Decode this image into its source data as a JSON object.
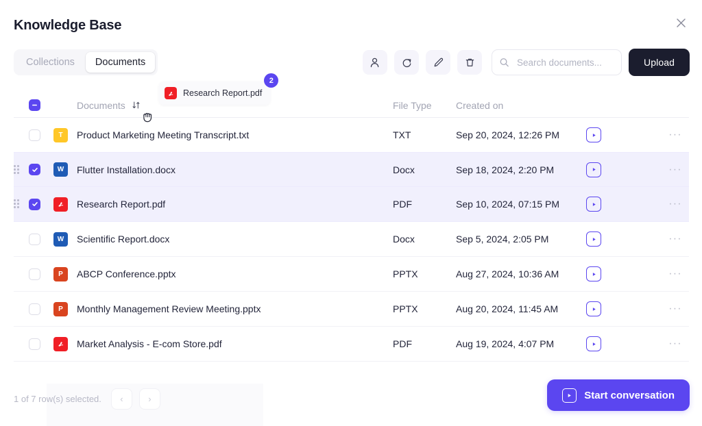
{
  "header": {
    "title": "Knowledge Base",
    "close_icon": "close-icon"
  },
  "tabs": [
    {
      "label": "Collections",
      "active": false
    },
    {
      "label": "Documents",
      "active": true
    }
  ],
  "toolbar": {
    "icons": [
      {
        "name": "user-icon",
        "label": "Share with user"
      },
      {
        "name": "refresh-icon",
        "label": "Re-sync"
      },
      {
        "name": "pencil-icon",
        "label": "Edit"
      },
      {
        "name": "trash-icon",
        "label": "Delete"
      }
    ],
    "search": {
      "placeholder": "Search documents...",
      "value": "",
      "icon": "search-icon"
    },
    "upload_label": "Upload"
  },
  "table": {
    "columns": {
      "name": "Documents",
      "file_type": "File Type",
      "created_on": "Created on"
    },
    "header_checkbox_state": "indeterminate",
    "sort_icon": "sort-arrows-icon",
    "rows": [
      {
        "selected": false,
        "icon": "txt",
        "icon_letter": "T",
        "name": "Product Marketing Meeting Transcript.txt",
        "file_type": "TXT",
        "created_on": "Sep 20, 2024, 12:26 PM",
        "action_icon": "play-icon",
        "more_icon": "more-horizontal-icon"
      },
      {
        "selected": true,
        "icon": "docx",
        "icon_letter": "W",
        "name": "Flutter Installation.docx",
        "file_type": "Docx",
        "created_on": "Sep 18, 2024, 2:20 PM",
        "action_icon": "play-icon",
        "more_icon": "more-horizontal-icon"
      },
      {
        "selected": true,
        "icon": "pdf",
        "icon_letter": "A",
        "name": "Research Report.pdf",
        "file_type": "PDF",
        "created_on": "Sep 10, 2024, 07:15 PM",
        "action_icon": "play-icon",
        "more_icon": "more-horizontal-icon"
      },
      {
        "selected": false,
        "icon": "docx",
        "icon_letter": "W",
        "name": "Scientific Report.docx",
        "file_type": "Docx",
        "created_on": "Sep 5, 2024, 2:05 PM",
        "action_icon": "play-icon",
        "more_icon": "more-horizontal-icon"
      },
      {
        "selected": false,
        "icon": "pptx",
        "icon_letter": "P",
        "name": "ABCP Conference.pptx",
        "file_type": "PPTX",
        "created_on": "Aug 27, 2024, 10:36 AM",
        "action_icon": "play-icon",
        "more_icon": "more-horizontal-icon"
      },
      {
        "selected": false,
        "icon": "pptx",
        "icon_letter": "P",
        "name": "Monthly Management Review Meeting.pptx",
        "file_type": "PPTX",
        "created_on": "Aug 20, 2024, 11:45 AM",
        "action_icon": "play-icon",
        "more_icon": "more-horizontal-icon"
      },
      {
        "selected": false,
        "icon": "pdf",
        "icon_letter": "A",
        "name": "Market Analysis - E-com Store.pdf",
        "file_type": "PDF",
        "created_on": "Aug 19, 2024, 4:07 PM",
        "action_icon": "play-icon",
        "more_icon": "more-horizontal-icon"
      }
    ]
  },
  "footer": {
    "selection_text": "1 of 7 row(s) selected.",
    "prev_label": "‹",
    "next_label": "›",
    "start_conversation_label": "Start conversation"
  },
  "drag": {
    "ghost_label": "Research Report.pdf",
    "ghost_icon": "pdf",
    "badge_count": "2",
    "cursor": "grabbing-hand-cursor"
  },
  "colors": {
    "accent": "#5B46F0",
    "selected_row_bg": "#F1F0FD",
    "upload_bg": "#1B1D2E",
    "txt": "#FFC728",
    "docx": "#1F5BB5",
    "pptx": "#D9441F",
    "pdf": "#F01F26"
  }
}
